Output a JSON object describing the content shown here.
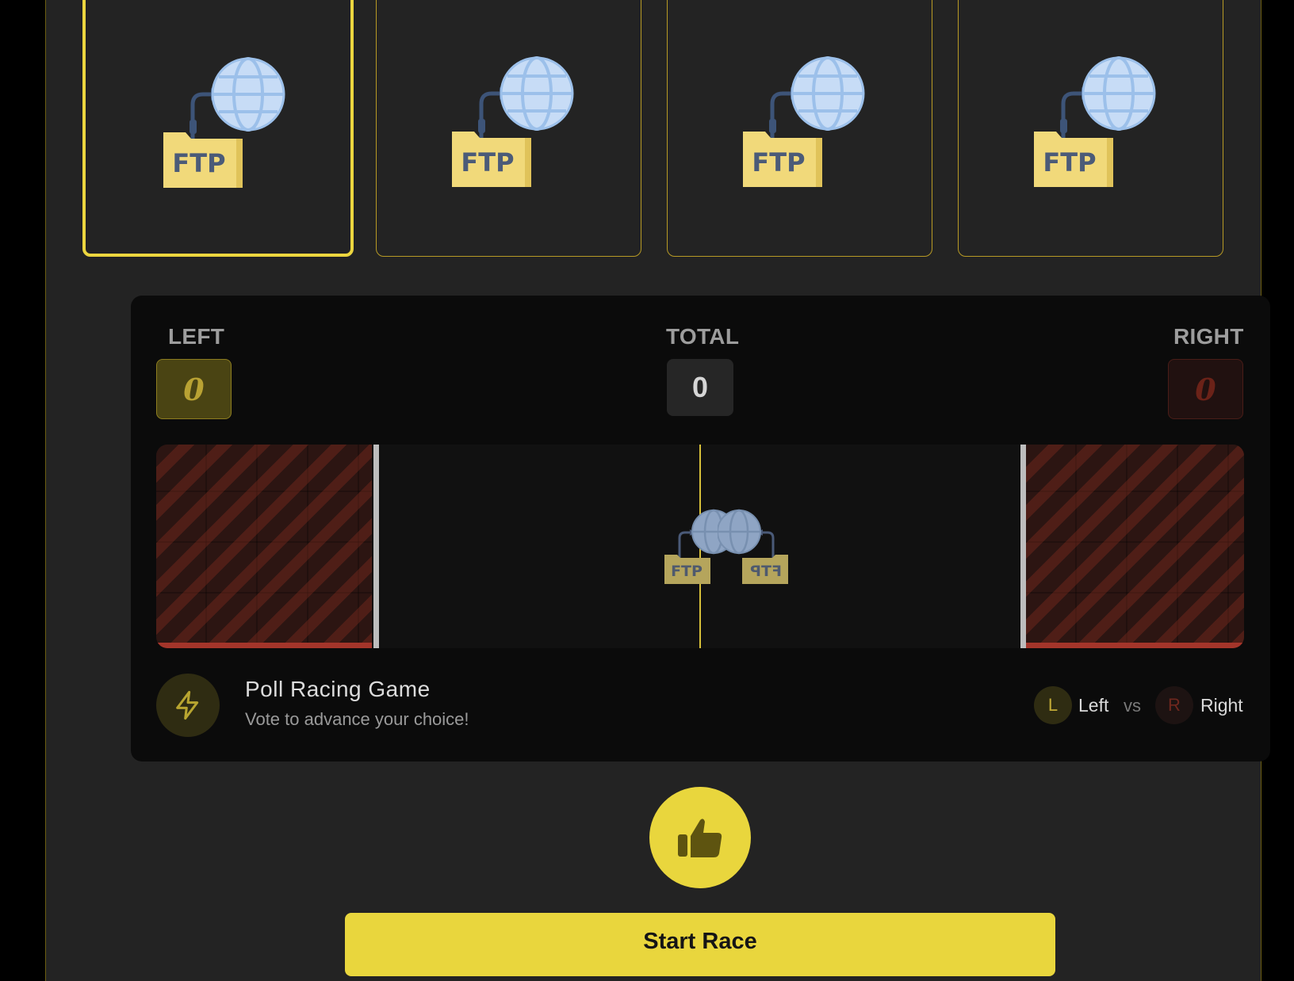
{
  "choices": [
    {
      "label": "FTP",
      "icon": "ftp-globe-icon",
      "selected": true
    },
    {
      "label": "FTP",
      "icon": "ftp-globe-icon",
      "selected": false
    },
    {
      "label": "FTP",
      "icon": "ftp-globe-icon",
      "selected": false
    },
    {
      "label": "FTP",
      "icon": "ftp-globe-icon",
      "selected": false
    }
  ],
  "scoreboard": {
    "left_label": "LEFT",
    "total_label": "TOTAL",
    "right_label": "RIGHT",
    "left_score": "0",
    "total_score": "0",
    "right_score": "0"
  },
  "track": {
    "left_racer": {
      "label": "FTP",
      "icon": "ftp-globe-icon"
    },
    "right_racer": {
      "label": "FTP",
      "icon": "ftp-globe-icon-mirrored"
    }
  },
  "info": {
    "icon": "lightning-icon",
    "title": "Poll Racing Game",
    "subtitle": "Vote to advance your choice!"
  },
  "legend": {
    "left_badge": "L",
    "left_text": "Left",
    "vs": "vs",
    "right_badge": "R",
    "right_text": "Right"
  },
  "vote_button": {
    "icon": "thumbs-up-icon"
  },
  "start_button": {
    "label": "Start Race"
  },
  "colors": {
    "accent": "#e9d63d",
    "background": "#232323",
    "stage": "#0b0b0b",
    "finish_zone": "#2c1512",
    "right_red": "#a4352a"
  }
}
